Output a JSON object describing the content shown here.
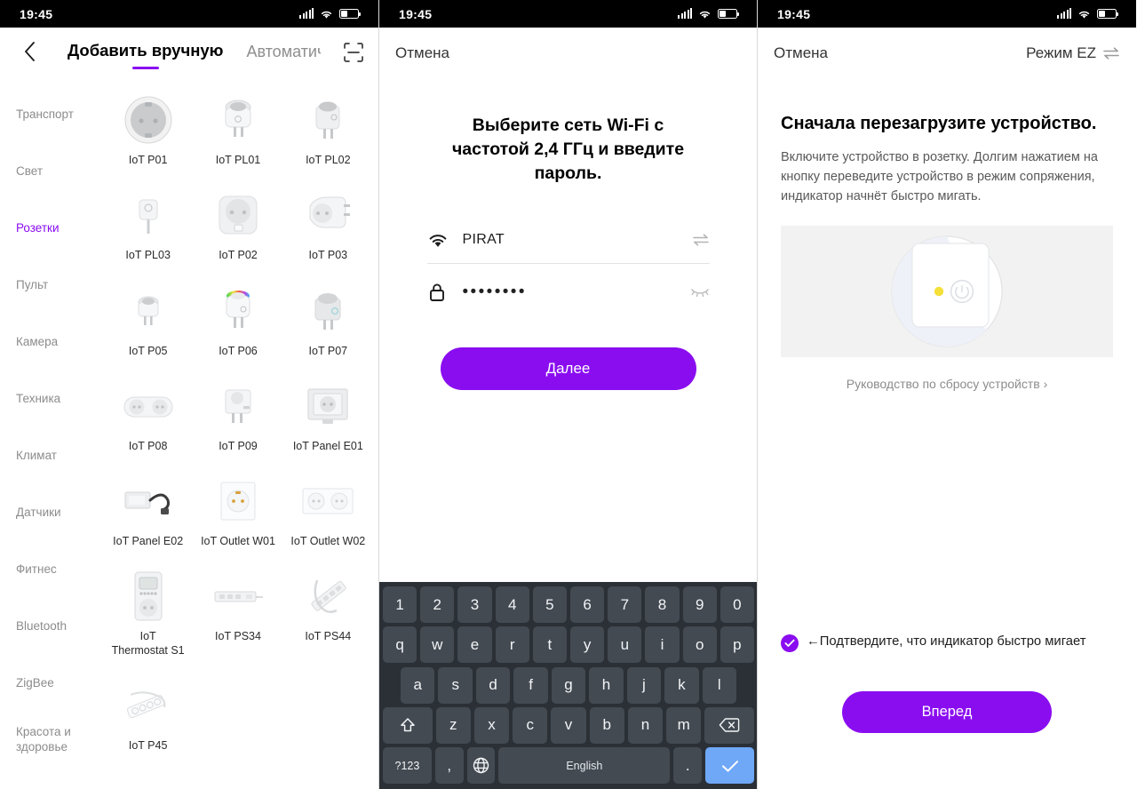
{
  "status_bar": {
    "time": "19:45",
    "signal_icon": "signal-bars-icon",
    "wifi_icon": "wifi-icon",
    "battery_icon": "battery-icon"
  },
  "accent_color": "#8a0df0",
  "screen1": {
    "back_icon": "chevron-left-icon",
    "tab_manual": "Добавить вручную",
    "tab_auto": "Автоматич",
    "scan_icon": "scan-qr-icon",
    "categories": [
      {
        "label": "Транспорт",
        "active": false
      },
      {
        "label": "Свет",
        "active": false
      },
      {
        "label": "Розетки",
        "active": true
      },
      {
        "label": "Пульт",
        "active": false
      },
      {
        "label": "Камера",
        "active": false
      },
      {
        "label": "Техника",
        "active": false
      },
      {
        "label": "Климат",
        "active": false
      },
      {
        "label": "Датчики",
        "active": false
      },
      {
        "label": "Фитнес",
        "active": false
      },
      {
        "label": "Bluetooth",
        "active": false
      },
      {
        "label": "ZigBee",
        "active": false
      },
      {
        "label": "Красота и здоровье",
        "active": false
      }
    ],
    "products": [
      {
        "name": "IoT P01",
        "art": "round-socket"
      },
      {
        "name": "IoT PL01",
        "art": "plug-round"
      },
      {
        "name": "IoT PL02",
        "art": "plug-block"
      },
      {
        "name": "IoT PL03",
        "art": "plug-small"
      },
      {
        "name": "IoT P02",
        "art": "square-socket"
      },
      {
        "name": "IoT P03",
        "art": "plug-angled"
      },
      {
        "name": "IoT P05",
        "art": "plug-tiny"
      },
      {
        "name": "IoT P06",
        "art": "plug-rgb"
      },
      {
        "name": "IoT P07",
        "art": "plug-cube"
      },
      {
        "name": "IoT P08",
        "art": "double-socket"
      },
      {
        "name": "IoT P09",
        "art": "plug-usb"
      },
      {
        "name": "IoT Panel E01",
        "art": "wall-panel"
      },
      {
        "name": "IoT Panel E02",
        "art": "panel-cable"
      },
      {
        "name": "IoT Outlet W01",
        "art": "glass-outlet-1"
      },
      {
        "name": "IoT Outlet W02",
        "art": "glass-outlet-2"
      },
      {
        "name": "IoT Thermostat S1",
        "art": "thermostat"
      },
      {
        "name": "IoT PS34",
        "art": "power-strip-flat"
      },
      {
        "name": "IoT PS44",
        "art": "power-strip-diag"
      },
      {
        "name": "IoT P45",
        "art": "power-strip-small"
      }
    ]
  },
  "screen2": {
    "cancel": "Отмена",
    "title": "Выберите сеть Wi-Fi с частотой 2,4 ГГц и введите пароль.",
    "wifi_icon": "wifi-icon",
    "ssid": "PIRAT",
    "swap_icon": "swap-arrows-icon",
    "lock_icon": "lock-icon",
    "password": "••••••••",
    "eye_icon": "eye-off-icon",
    "next_button": "Далее",
    "keyboard": {
      "row_numbers": [
        "1",
        "2",
        "3",
        "4",
        "5",
        "6",
        "7",
        "8",
        "9",
        "0"
      ],
      "row_top": [
        "q",
        "w",
        "e",
        "r",
        "t",
        "y",
        "u",
        "i",
        "o",
        "p"
      ],
      "row_home": [
        "a",
        "s",
        "d",
        "f",
        "g",
        "h",
        "j",
        "k",
        "l"
      ],
      "row_bottom": [
        "z",
        "x",
        "c",
        "v",
        "b",
        "n",
        "m"
      ],
      "shift_key": "shift-icon",
      "backspace_key": "backspace-icon",
      "symbols_key": "?123",
      "comma_key": ",",
      "globe_key": "globe-icon",
      "space_key": "English",
      "period_key": ".",
      "enter_key": "check-icon"
    }
  },
  "screen3": {
    "cancel": "Отмена",
    "mode": "Режим EZ",
    "mode_icon": "swap-arrows-icon",
    "title": "Сначала перезагрузите устройство.",
    "subtitle": "Включите устройство в розетку. Долгим нажатием на кнопку переведите устройство в режим сопряжения, индикатор начнёт быстро мигать.",
    "device_illustration": "smart-plug-power-button-illustration",
    "indicator_color": "#f5e03a",
    "reset_guide": "Руководство по сбросу устройств",
    "reset_guide_chevron": "chevron-right-icon",
    "confirm_checkbox_icon": "check-icon",
    "confirm_text": "←Подтвердите, что индикатор быстро мигает",
    "forward_button": "Вперед"
  }
}
